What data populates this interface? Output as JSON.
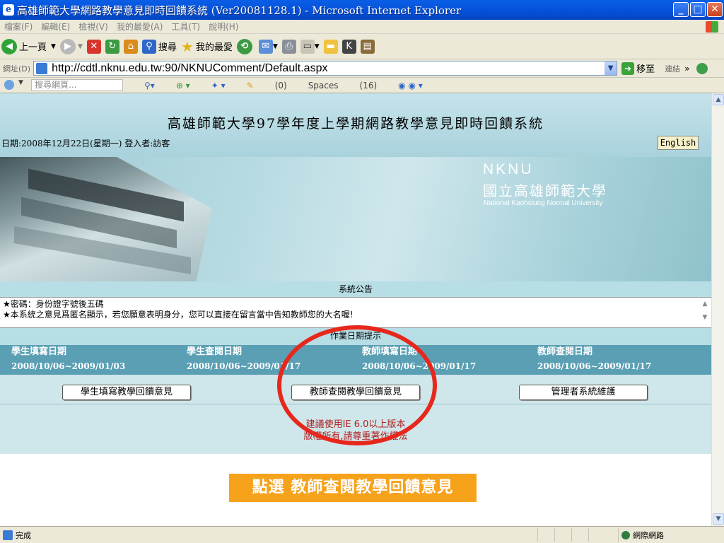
{
  "window": {
    "title": "高雄師範大學網路教學意見即時回饋系統 (Ver20081128.1) - Microsoft Internet Explorer",
    "minimize": "_",
    "maximize": "□",
    "close": "✕"
  },
  "menu": [
    "檔案(F)",
    "編輯(E)",
    "檢視(V)",
    "我的最愛(A)",
    "工具(T)",
    "說明(H)"
  ],
  "toolbar": {
    "back": "上一頁",
    "search": "搜尋",
    "favorites": "我的最愛"
  },
  "address": {
    "label": "網址(D)",
    "url": "http://cdtl.nknu.edu.tw:90/NKNUComment/Default.aspx",
    "go": "移至",
    "links": "連結"
  },
  "linksbar": {
    "search_placeholder": "搜尋網頁...",
    "mail": "(0)",
    "spaces": "Spaces",
    "messenger": "(16)"
  },
  "page": {
    "site_title": "高雄師範大學97學年度上學期網路教學意見即時回饋系統",
    "date_line": "日期:2008年12月22日(星期一) 登入者:訪客",
    "english": "English",
    "banner": {
      "nknu": "NKNU",
      "name_zh": "國立高雄師範大學",
      "name_en": "National Kaohsiung Normal University"
    },
    "announcement_title": "系統公告",
    "announcements": [
      "★密碼：身份證字號後五碼",
      "★本系統之意見爲匿名顯示，若您願意表明身分，您可以直接在留言當中告知教師您的大名喔!"
    ],
    "schedule_title": "作業日期提示",
    "schedule_headers": [
      "學生填寫日期",
      "學生查閱日期",
      "教師填寫日期",
      "教師查閱日期"
    ],
    "schedule_dates": [
      "2008/10/06~2009/01/03",
      "2008/10/06~2009/01/17",
      "2008/10/06~2009/01/17",
      "2008/10/06~2009/01/17"
    ],
    "buttons": {
      "student_fill": "學生填寫教學回饋意見",
      "teacher_view": "教師查閱教學回饋意見",
      "admin": "管理者系統維護"
    },
    "notice": [
      "建議使用IE 6.0以上版本",
      "版權所有,請尊重著作權法"
    ],
    "callout": "點選 教師查閱教學回饋意見"
  },
  "status": {
    "text": "完成",
    "zone": "網際網路"
  }
}
